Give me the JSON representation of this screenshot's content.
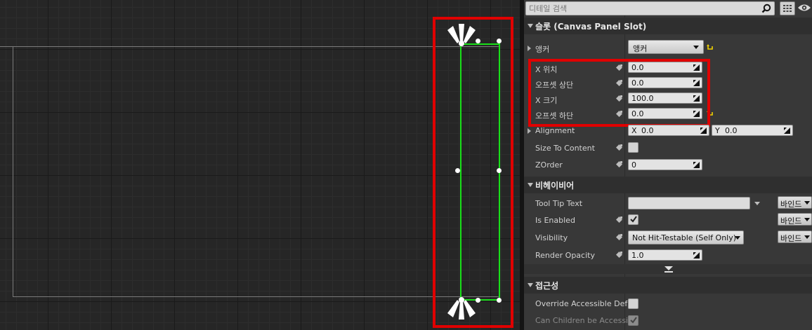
{
  "details": {
    "search_placeholder": "디테일 검색",
    "categories": {
      "slot": "슬롯 (Canvas Panel Slot)",
      "behavior": "비헤이비어",
      "accessibility": "접근성"
    },
    "anchors": {
      "label": "앵커",
      "value": "앵커"
    },
    "offsets": {
      "x_pos": {
        "label": "X 위치",
        "value": "0.0"
      },
      "offset_top": {
        "label": "오프셋 상단",
        "value": "0.0"
      },
      "x_size": {
        "label": "X 크기",
        "value": "100.0"
      },
      "offset_bottom": {
        "label": "오프셋 하단",
        "value": "0.0"
      }
    },
    "alignment": {
      "label": "Alignment",
      "x_prefix": "X",
      "x_value": "0.0",
      "y_prefix": "Y",
      "y_value": "0.0"
    },
    "size_to_content": {
      "label": "Size To Content",
      "checked": false
    },
    "zorder": {
      "label": "ZOrder",
      "value": "0"
    },
    "tooltip": {
      "label": "Tool Tip Text",
      "value": "",
      "bind_label": "바인드"
    },
    "is_enabled": {
      "label": "Is Enabled",
      "checked": true,
      "bind_label": "바인드"
    },
    "visibility": {
      "label": "Visibility",
      "value": "Not Hit-Testable (Self Only)",
      "bind_label": "바인드"
    },
    "render_opacity": {
      "label": "Render Opacity",
      "value": "1.0"
    },
    "override_accessible": {
      "label": "Override Accessible Defa",
      "checked": false
    },
    "can_children": {
      "label": "Can Children be Accessib",
      "checked": true
    }
  },
  "colors": {
    "highlight": "#e00000",
    "selection": "#19e019",
    "reset_arrow": "#f2d200"
  }
}
